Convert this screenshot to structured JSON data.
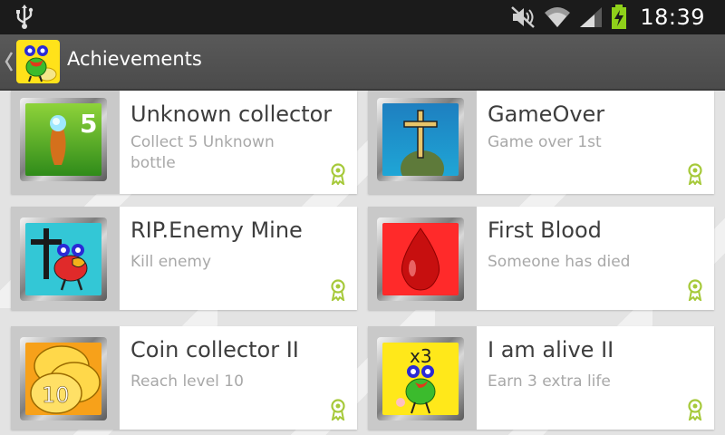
{
  "status": {
    "time": "18:39",
    "icons": [
      "usb-icon",
      "mute-icon",
      "wifi-icon",
      "signal-icon",
      "battery-charging-icon"
    ]
  },
  "actionbar": {
    "title": "Achievements",
    "icons": [
      "up-caret-icon",
      "app-icon"
    ]
  },
  "achievements": [
    {
      "title": "Unknown collector",
      "description": "Collect 5 Unknown bottle",
      "badge": "5",
      "icon": "bottle-icon"
    },
    {
      "title": "GameOver",
      "description": "Game over 1st",
      "icon": "grave-cross-icon"
    },
    {
      "title": "RIP.Enemy Mine",
      "description": "Kill enemy",
      "icon": "enemy-cross-icon"
    },
    {
      "title": "First Blood",
      "description": "Someone has died",
      "icon": "blood-drop-icon"
    },
    {
      "title": "Coin collector II",
      "description": "Reach level 10",
      "badge": "10",
      "icon": "coins-icon"
    },
    {
      "title": "I am alive II",
      "description": "Earn 3 extra life",
      "badge": "x3",
      "icon": "frog-icon"
    }
  ],
  "colors": {
    "award": "#a6c93a",
    "statusbar": "#1b1b1b",
    "actionbar": "#505050"
  }
}
